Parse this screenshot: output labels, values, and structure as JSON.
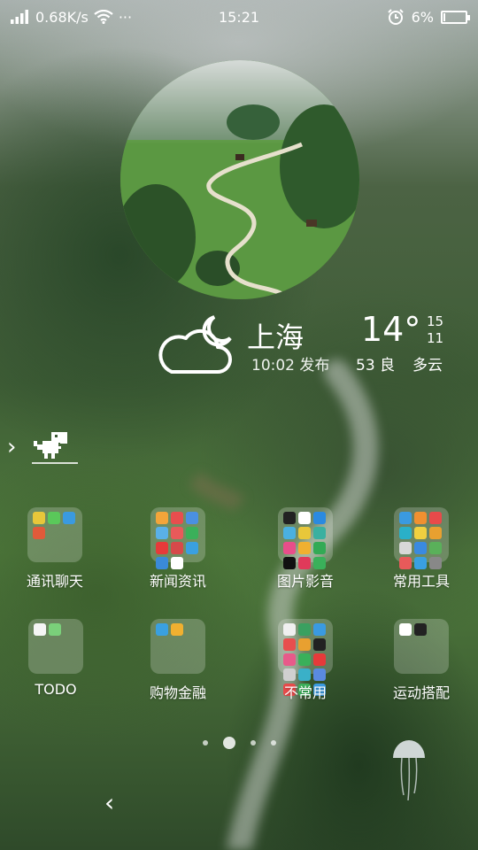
{
  "status_bar": {
    "network_speed": "0.68K/s",
    "more": "···",
    "time": "15:21",
    "battery_percent": "6%",
    "battery_level": 0.06,
    "icons": [
      "signal-icon",
      "wifi-icon",
      "alarm-icon",
      "battery-icon"
    ]
  },
  "weather": {
    "city": "上海",
    "publish_time": "10:02 发布",
    "temperature": "14°",
    "temp_high": "15",
    "temp_low": "11",
    "aqi": "53 良",
    "condition": "多云",
    "icon": "cloud-moon-icon"
  },
  "folders": [
    {
      "label": "通讯聊天",
      "icons": [
        "#e8c73a",
        "#5ac85a",
        "#3a9ae0",
        "#e05a3a"
      ]
    },
    {
      "label": "新闻资讯",
      "icons": [
        "#f3a53a",
        "#e84e4e",
        "#4a90e2",
        "#5ab0e8",
        "#e85a5a",
        "#3ab05a",
        "#e63a3a",
        "#d64a4a",
        "#3aa0e0",
        "#3a8ad8",
        "#ffffff"
      ]
    },
    {
      "label": "图片影音",
      "icons": [
        "#222222",
        "#ffffff",
        "#2a8ae0",
        "#4ab0e0",
        "#e8c73a",
        "#3ab0a0",
        "#e84e8a",
        "#f0b030",
        "#33aa55",
        "#111111",
        "#e03a5a",
        "#3ab05a"
      ]
    },
    {
      "label": "常用工具",
      "icons": [
        "#3a9ae0",
        "#f09030",
        "#e84a4a",
        "#2ab0c8",
        "#f0d040",
        "#e8a030",
        "#d8d8d8",
        "#3a8ae0",
        "#5ab05a",
        "#e85a5a",
        "#3aa0e0",
        "#888888"
      ]
    },
    {
      "label": "TODO",
      "icons": [
        "#f5f5f5",
        "#7ad07a"
      ]
    },
    {
      "label": "购物金融",
      "icons": [
        "#3aa0e0",
        "#f0b030"
      ]
    },
    {
      "label": "不常用",
      "icons": [
        "#f0f0f0",
        "#3aa060",
        "#3a9ae0",
        "#e84e4e",
        "#e8a030",
        "#222222",
        "#e85a8a",
        "#3ab05a",
        "#e63a3a",
        "#d0d0d0",
        "#3ab0c8",
        "#5a8ae0",
        "#e84a4a",
        "#3ab05a",
        "#3a9ae0"
      ]
    },
    {
      "label": "运动搭配",
      "icons": [
        "#ffffff",
        "#222222"
      ]
    }
  ],
  "pager": {
    "pages": 4,
    "active_index": 1
  }
}
